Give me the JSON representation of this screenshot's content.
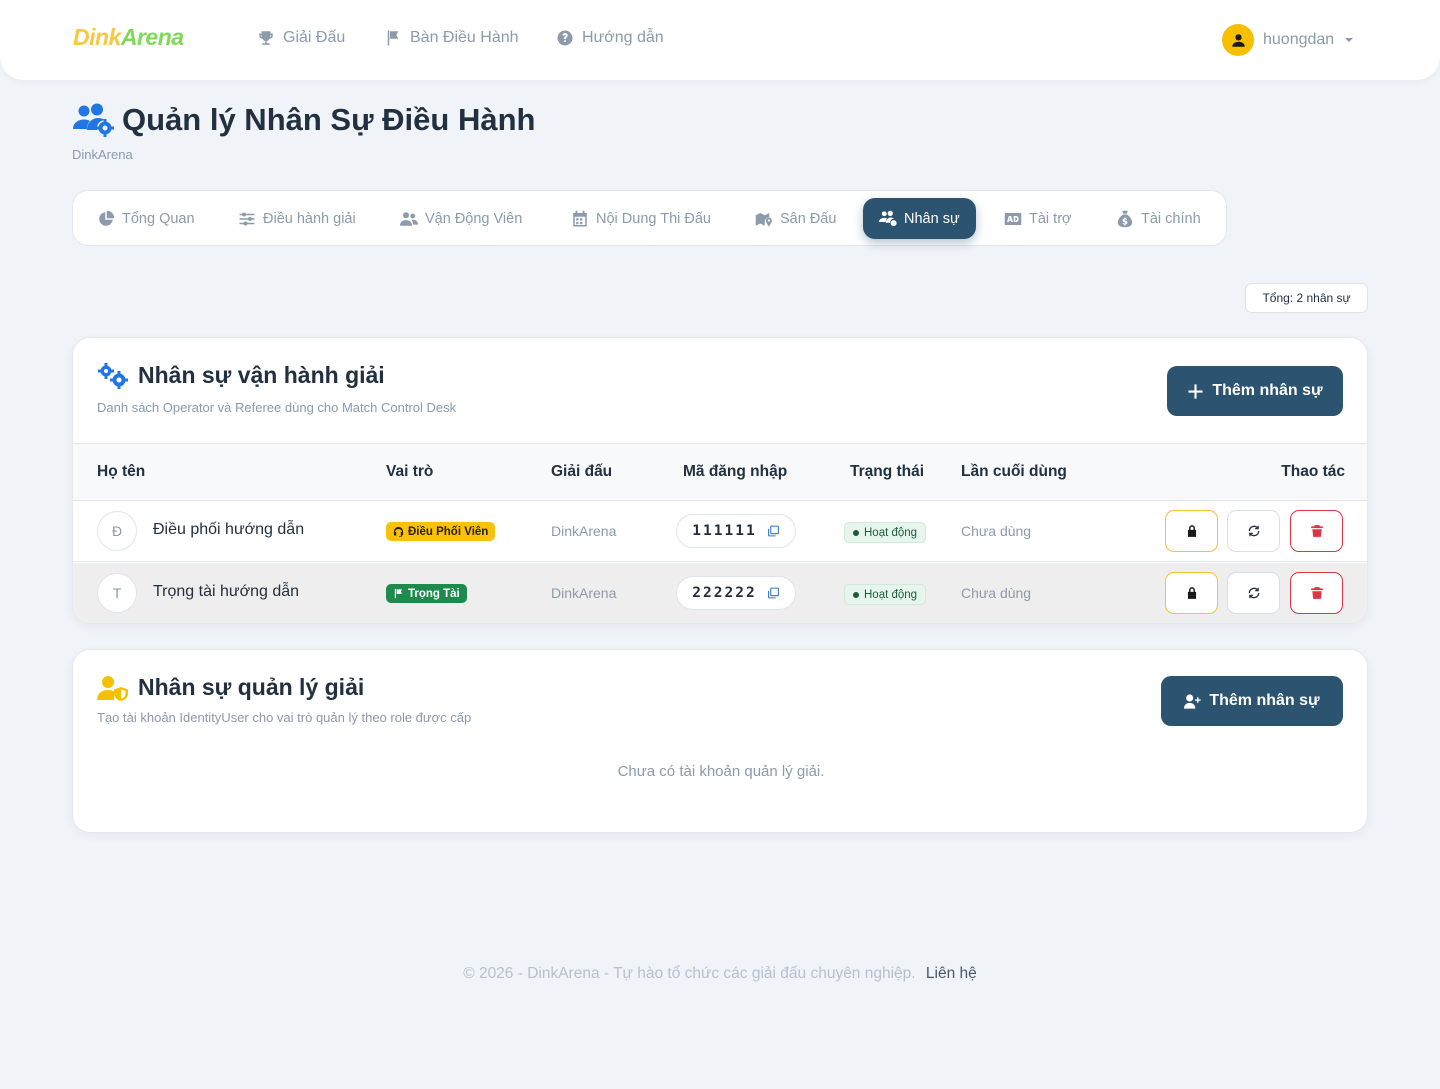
{
  "nav": {
    "brand_part1": "Dink",
    "brand_part2": "Arena",
    "links": [
      {
        "label": "Giải Đấu",
        "icon": "trophy-icon"
      },
      {
        "label": "Bàn Điều Hành",
        "icon": "flag-icon"
      },
      {
        "label": "Hướng dẫn",
        "icon": "question-circle-icon"
      }
    ],
    "username": "huongdan"
  },
  "page": {
    "title": "Quản lý Nhân Sự Điều Hành",
    "subtitle": "DinkArena"
  },
  "tabs": [
    {
      "label": "Tổng Quan",
      "icon": "pie-chart-icon",
      "active": false
    },
    {
      "label": "Điều hành giải",
      "icon": "sliders-icon",
      "active": false
    },
    {
      "label": "Vận Động Viên",
      "icon": "users-icon",
      "active": false
    },
    {
      "label": "Nội Dung Thi Đấu",
      "icon": "calendar-icon",
      "active": false
    },
    {
      "label": "Sân Đấu",
      "icon": "map-icon",
      "active": false
    },
    {
      "label": "Nhân sự",
      "icon": "users-gear-icon",
      "active": true
    },
    {
      "label": "Tài trợ",
      "icon": "ad-icon",
      "active": false
    },
    {
      "label": "Tài chính",
      "icon": "money-bag-icon",
      "active": false
    }
  ],
  "total_badge": "Tổng: 2 nhân sự",
  "operators": {
    "title": "Nhân sự vận hành giải",
    "subtitle": "Danh sách Operator và Referee dùng cho Match Control Desk",
    "add_label": "Thêm nhân sự",
    "columns": [
      "Họ tên",
      "Vai trò",
      "Giải đấu",
      "Mã đăng nhập",
      "Trạng thái",
      "Lần cuối dùng",
      "Thao tác"
    ],
    "rows": [
      {
        "initial": "Đ",
        "name": "Điều phối hướng dẫn",
        "role": "Điều Phối Viên",
        "role_type": "coordinator",
        "tournament": "DinkArena",
        "code": "111111",
        "status": "Hoạt động",
        "last_used": "Chưa dùng"
      },
      {
        "initial": "T",
        "name": "Trọng tài hướng dẫn",
        "role": "Trọng Tài",
        "role_type": "referee",
        "tournament": "DinkArena",
        "code": "222222",
        "status": "Hoạt động",
        "last_used": "Chưa dùng"
      }
    ]
  },
  "managers": {
    "title": "Nhân sự quản lý giải",
    "subtitle": "Tạo tài khoản IdentityUser cho vai trò quản lý theo role được cấp",
    "add_label": "Thêm nhân sự",
    "empty_text": "Chưa có tài khoản quản lý giải."
  },
  "footer": {
    "text": "© 2026 - DinkArena - Tự hào tổ chức các giải đấu chuyên nghiệp.",
    "link": "Liên hệ"
  },
  "colors": {
    "primary": "#2c5470",
    "accent_yellow": "#f9c107",
    "referee_green": "#1e8a4e",
    "danger": "#dc3545",
    "page_bg": "#f0f3f8"
  }
}
